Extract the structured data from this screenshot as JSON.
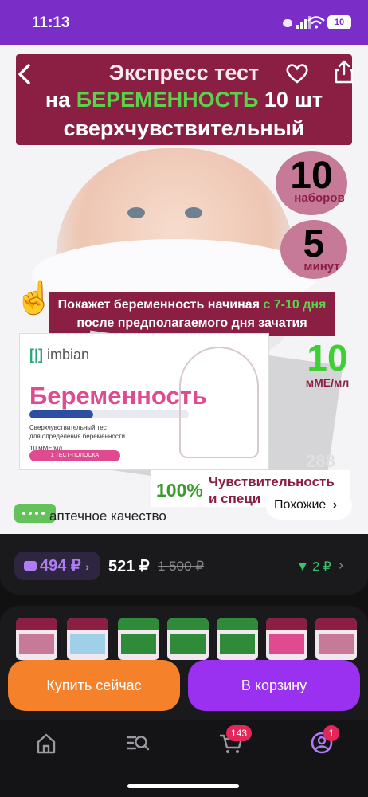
{
  "status_bar": {
    "time": "11:13",
    "battery": "10"
  },
  "product": {
    "title_line1": "Экспресс тест",
    "title_line2_prefix": "на ",
    "title_line2_highlight": "БЕРЕМЕННОСТЬ",
    "title_line2_suffix": " 10 шт",
    "title_line3": "сверхчувствительный",
    "badge_sets_number": "10",
    "badge_sets_label": "наборов",
    "badge_minutes_number": "5",
    "badge_minutes_label": "минут",
    "info_part1": "Покажет беременность  начиная ",
    "info_highlight": "с 7-10 дня",
    "info_part2": " после предполагаемого дня зачатия",
    "box_logo": "imbian",
    "box_brand": "Беременность",
    "box_sub_line1": "Сверхчувствительный тест",
    "box_sub_line2": "для определения беременности",
    "box_sub_line3": "10 мМЕ/мл",
    "box_pill": "1 ТЕСТ-ПОЛОСКА",
    "sensitivity_number": "10",
    "sensitivity_unit": "мМЕ/мл",
    "percent": "100%",
    "percent_text_line1": "Чувствительность",
    "percent_text_line2": "и специ",
    "pharmacy_text": "аптечное качество",
    "watermark": "288",
    "similar_label": "Похожие"
  },
  "price": {
    "wallet_price": "494 ₽",
    "current_price": "521 ₽",
    "old_price": "1 500 ₽",
    "points": "2 ₽"
  },
  "actions": {
    "buy_now": "Купить сейчас",
    "add_to_cart": "В корзину"
  },
  "tabbar": {
    "cart_badge": "143",
    "profile_badge": "1"
  },
  "colors": {
    "accent_purple": "#9a30f0",
    "buy_orange": "#f5812a",
    "banner_burgundy": "#8b1f43",
    "highlight_green": "#58d34a"
  }
}
